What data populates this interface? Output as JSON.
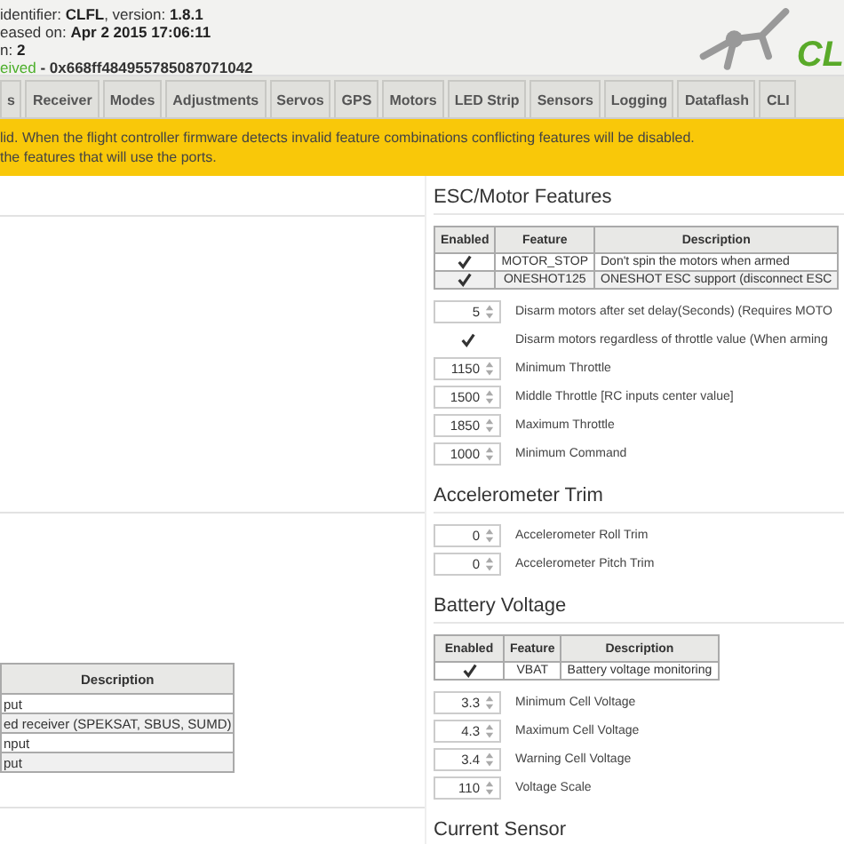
{
  "header": {
    "info": [
      "identifier: **CLFL**, version: **1.8.1**",
      "eased on: **Apr 2 2015 17:06:11**",
      "n: **2**"
    ],
    "uid": {
      "status": "eived",
      "value": "- 0x668ff484955785087071042"
    },
    "logo": {
      "text": "CL"
    }
  },
  "tabs": [
    {
      "label": "s",
      "selected": false
    },
    {
      "label": "Receiver",
      "selected": false
    },
    {
      "label": "Modes",
      "selected": false
    },
    {
      "label": "Adjustments",
      "selected": false
    },
    {
      "label": "Servos",
      "selected": false
    },
    {
      "label": "GPS",
      "selected": false
    },
    {
      "label": "Motors",
      "selected": false
    },
    {
      "label": "LED Strip",
      "selected": false
    },
    {
      "label": "Sensors",
      "selected": false
    },
    {
      "label": "Logging",
      "selected": false
    },
    {
      "label": "Dataflash",
      "selected": false
    },
    {
      "label": "CLI",
      "selected": false
    }
  ],
  "warning": [
    "lid. When the flight controller firmware detects invalid feature combinations conflicting features will be disabled.",
    "the features that will use the ports."
  ],
  "receiver_table": {
    "columns": [
      "Description"
    ],
    "rows": [
      "put",
      "ed receiver (SPEKSAT, SBUS, SUMD)",
      "nput",
      "put"
    ]
  },
  "esc_motor": {
    "title": "ESC/Motor Features",
    "columns": [
      "Enabled",
      "Feature",
      "Description"
    ],
    "rows": [
      {
        "checked": true,
        "feature": "MOTOR_STOP",
        "description": "Don't spin the motors when armed"
      },
      {
        "checked": true,
        "feature": "ONESHOT125",
        "description": "ONESHOT ESC support (disconnect ESC"
      }
    ],
    "settings": [
      {
        "kind": "number",
        "value": "5",
        "label": "Disarm motors after set delay(Seconds) (Requires MOTO"
      },
      {
        "kind": "checkbox",
        "checked": true,
        "label": "Disarm motors regardless of throttle value (When arming"
      },
      {
        "kind": "number",
        "value": "1150",
        "label": "Minimum Throttle"
      },
      {
        "kind": "number",
        "value": "1500",
        "label": "Middle Throttle [RC inputs center value]"
      },
      {
        "kind": "number",
        "value": "1850",
        "label": "Maximum Throttle"
      },
      {
        "kind": "number",
        "value": "1000",
        "label": "Minimum Command"
      }
    ]
  },
  "accelerometer_trim": {
    "title": "Accelerometer Trim",
    "settings": [
      {
        "kind": "number",
        "value": "0",
        "label": "Accelerometer Roll Trim"
      },
      {
        "kind": "number",
        "value": "0",
        "label": "Accelerometer Pitch Trim"
      }
    ]
  },
  "battery_voltage": {
    "title": "Battery Voltage",
    "columns": [
      "Enabled",
      "Feature",
      "Description"
    ],
    "rows": [
      {
        "checked": true,
        "feature": "VBAT",
        "description": "Battery voltage monitoring"
      }
    ],
    "settings": [
      {
        "kind": "number",
        "value": "3.3",
        "label": "Minimum Cell Voltage"
      },
      {
        "kind": "number",
        "value": "4.3",
        "label": "Maximum Cell Voltage"
      },
      {
        "kind": "number",
        "value": "3.4",
        "label": "Warning Cell Voltage"
      },
      {
        "kind": "number",
        "value": "110",
        "label": "Voltage Scale"
      }
    ]
  },
  "current_sensor": {
    "title": "Current Sensor"
  }
}
